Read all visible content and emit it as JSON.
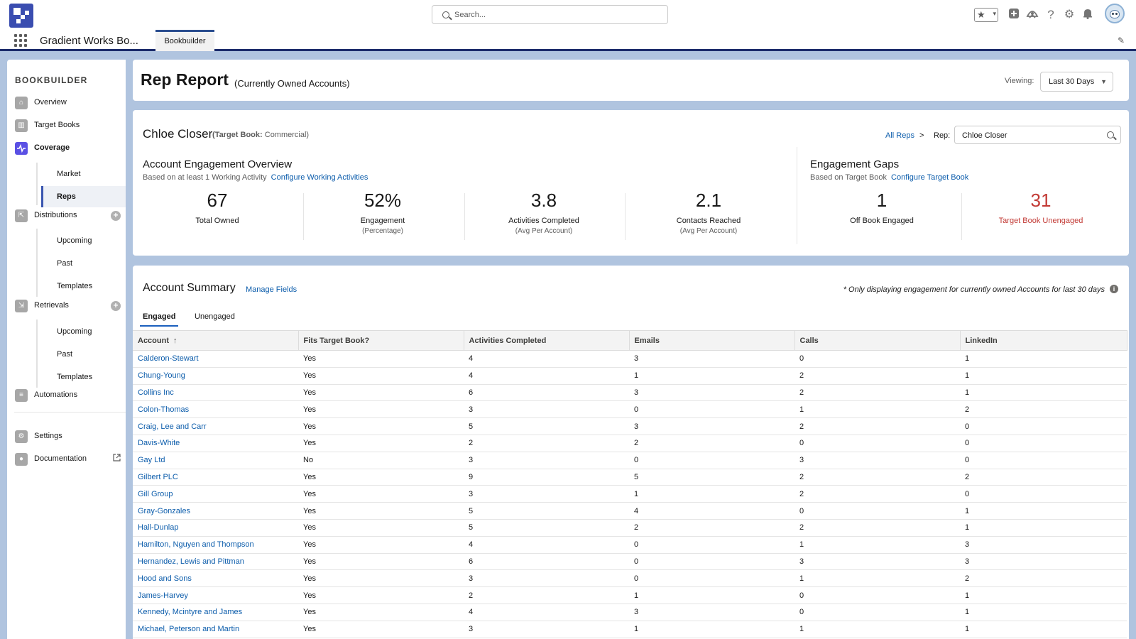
{
  "global_header": {
    "search_placeholder": "Search...",
    "icons": [
      "favorites-star-icon",
      "chevron-down-icon",
      "add-icon",
      "trailhead-icon",
      "help-icon",
      "setup-gear-icon",
      "notification-bell-icon",
      "user-avatar"
    ]
  },
  "app_nav": {
    "app_name": "Gradient Works Bo...",
    "tab_label": "Bookbuilder"
  },
  "sidebar": {
    "title": "BOOKBUILDER",
    "overview": "Overview",
    "target_books": "Target Books",
    "coverage": "Coverage",
    "coverage_children": [
      "Market",
      "Reps"
    ],
    "distributions": "Distributions",
    "distributions_children": [
      "Upcoming",
      "Past",
      "Templates"
    ],
    "retrievals": "Retrievals",
    "retrievals_children": [
      "Upcoming",
      "Past",
      "Templates"
    ],
    "automations": "Automations",
    "settings": "Settings",
    "documentation": "Documentation"
  },
  "report_header": {
    "title": "Rep Report",
    "subtitle": "(Currently Owned Accounts)",
    "viewing_label": "Viewing:",
    "viewing_value": "Last 30 Days"
  },
  "rep": {
    "name": "Chloe Closer",
    "target_book_prefix": "(Target Book:",
    "target_book_value": " Commercial)",
    "all_reps": "All Reps",
    "crumb_sep": ">",
    "rep_label": "Rep:",
    "rep_value": "Chloe Closer"
  },
  "engagement_overview": {
    "title": "Account Engagement Overview",
    "subtitle": "Based on at least 1 Working Activity",
    "link": "Configure Working Activities",
    "metrics": [
      {
        "value": "67",
        "label": "Total Owned",
        "sub": ""
      },
      {
        "value": "52%",
        "label": "Engagement",
        "sub": "(Percentage)"
      },
      {
        "value": "3.8",
        "label": "Activities Completed",
        "sub": "(Avg Per Account)"
      },
      {
        "value": "2.1",
        "label": "Contacts Reached",
        "sub": "(Avg Per Account)"
      }
    ]
  },
  "engagement_gaps": {
    "title": "Engagement Gaps",
    "subtitle": "Based on Target Book",
    "link": "Configure Target Book",
    "metrics": [
      {
        "value": "1",
        "label": "Off Book Engaged"
      },
      {
        "value": "31",
        "label": "Target Book Unengaged"
      }
    ],
    "alert_color": "#c23934"
  },
  "account_summary": {
    "title": "Account Summary",
    "manage_fields": "Manage Fields",
    "note": "* Only displaying engagement for currently owned Accounts for last 30 days",
    "tabs": [
      "Engaged",
      "Unengaged"
    ],
    "columns": [
      "Account",
      "Fits Target Book?",
      "Activities Completed",
      "Emails",
      "Calls",
      "LinkedIn"
    ],
    "sort_indicator": "↑",
    "rows": [
      [
        "Calderon-Stewart",
        "Yes",
        "4",
        "3",
        "0",
        "1"
      ],
      [
        "Chung-Young",
        "Yes",
        "4",
        "1",
        "2",
        "1"
      ],
      [
        "Collins Inc",
        "Yes",
        "6",
        "3",
        "2",
        "1"
      ],
      [
        "Colon-Thomas",
        "Yes",
        "3",
        "0",
        "1",
        "2"
      ],
      [
        "Craig, Lee and Carr",
        "Yes",
        "5",
        "3",
        "2",
        "0"
      ],
      [
        "Davis-White",
        "Yes",
        "2",
        "2",
        "0",
        "0"
      ],
      [
        "Gay Ltd",
        "No",
        "3",
        "0",
        "3",
        "0"
      ],
      [
        "Gilbert PLC",
        "Yes",
        "9",
        "5",
        "2",
        "2"
      ],
      [
        "Gill Group",
        "Yes",
        "3",
        "1",
        "2",
        "0"
      ],
      [
        "Gray-Gonzales",
        "Yes",
        "5",
        "4",
        "0",
        "1"
      ],
      [
        "Hall-Dunlap",
        "Yes",
        "5",
        "2",
        "2",
        "1"
      ],
      [
        "Hamilton, Nguyen and Thompson",
        "Yes",
        "4",
        "0",
        "1",
        "3"
      ],
      [
        "Hernandez, Lewis and Pittman",
        "Yes",
        "6",
        "0",
        "3",
        "3"
      ],
      [
        "Hood and Sons",
        "Yes",
        "3",
        "0",
        "1",
        "2"
      ],
      [
        "James-Harvey",
        "Yes",
        "2",
        "1",
        "0",
        "1"
      ],
      [
        "Kennedy, Mcintyre and James",
        "Yes",
        "4",
        "3",
        "0",
        "1"
      ],
      [
        "Michael, Peterson and Martin",
        "Yes",
        "3",
        "1",
        "1",
        "1"
      ]
    ]
  }
}
